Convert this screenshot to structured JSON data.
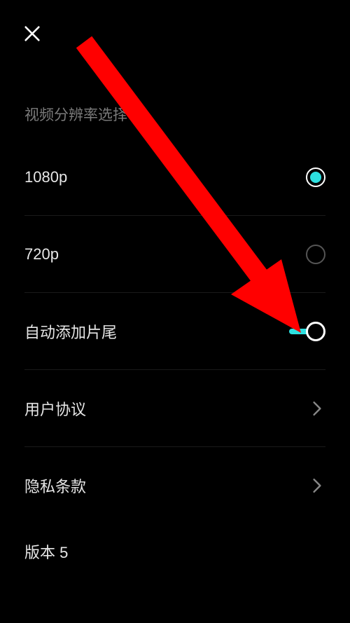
{
  "sectionTitle": "视频分辨率选择",
  "options": {
    "res1080": "1080p",
    "res720": "720p"
  },
  "settings": {
    "autoTail": "自动添加片尾",
    "userAgreement": "用户协议",
    "privacy": "隐私条款",
    "version": "版本 5"
  },
  "colors": {
    "accent": "#2de0e0",
    "arrow": "#ff0000"
  }
}
